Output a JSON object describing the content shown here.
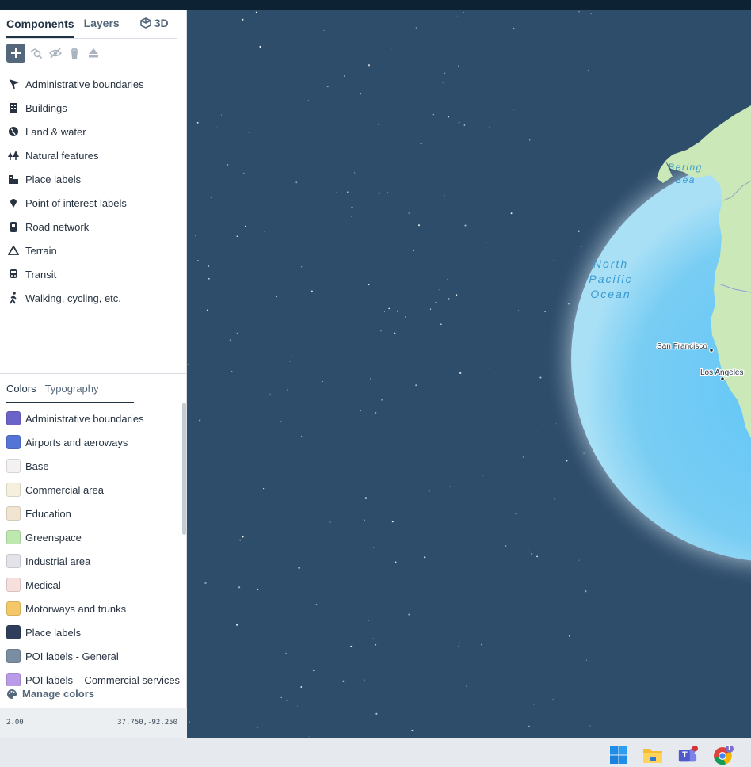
{
  "tabs": {
    "components": "Components",
    "layers": "Layers",
    "three_d": "3D"
  },
  "toolbar": {
    "icons": [
      "plus-icon",
      "search-layer-icon",
      "hide-icon",
      "trash-icon",
      "eject-icon"
    ]
  },
  "components": [
    {
      "label": "Administrative boundaries",
      "icon": "flag-icon"
    },
    {
      "label": "Buildings",
      "icon": "building-icon"
    },
    {
      "label": "Land & water",
      "icon": "globe-icon"
    },
    {
      "label": "Natural features",
      "icon": "trees-icon"
    },
    {
      "label": "Place labels",
      "icon": "place-icon"
    },
    {
      "label": "Point of interest labels",
      "icon": "pin-icon"
    },
    {
      "label": "Road network",
      "icon": "road-icon"
    },
    {
      "label": "Terrain",
      "icon": "mountain-icon"
    },
    {
      "label": "Transit",
      "icon": "train-icon"
    },
    {
      "label": "Walking, cycling, etc.",
      "icon": "walking-icon"
    }
  ],
  "color_tabs": {
    "colors": "Colors",
    "typography": "Typography"
  },
  "colors": [
    {
      "label": "Administrative boundaries",
      "color": "#6b63c9"
    },
    {
      "label": "Airports and aeroways",
      "color": "#5475d6"
    },
    {
      "label": "Base",
      "color": "#f3f1f1"
    },
    {
      "label": "Commercial area",
      "color": "#f5f0de"
    },
    {
      "label": "Education",
      "color": "#f1e5d1"
    },
    {
      "label": "Greenspace",
      "color": "#bde9b0"
    },
    {
      "label": "Industrial area",
      "color": "#e3e3ea"
    },
    {
      "label": "Medical",
      "color": "#f6dfdc"
    },
    {
      "label": "Motorways and trunks",
      "color": "#f4c868"
    },
    {
      "label": "Place labels",
      "color": "#2f3e5c"
    },
    {
      "label": "POI labels - General",
      "color": "#7a8ea1"
    },
    {
      "label": "POI labels – Commercial services",
      "color": "#b99be8"
    }
  ],
  "manage_colors": "Manage colors",
  "status": {
    "zoom": "2.00",
    "coords": "37.750,-92.250"
  },
  "map": {
    "labels": {
      "bering_1": "Bering",
      "bering_2": "Sea",
      "npo_1": "North",
      "npo_2": "Pacific",
      "npo_3": "Ocean",
      "sf": "San Francisco",
      "la": "Los Angeles"
    },
    "colors": {
      "space": "#2e4d6b",
      "ocean": "#6cc6f3",
      "land": "#c8e6b8"
    }
  },
  "taskbar": {
    "teams_badge": "T",
    "chrome_badge": "T"
  }
}
